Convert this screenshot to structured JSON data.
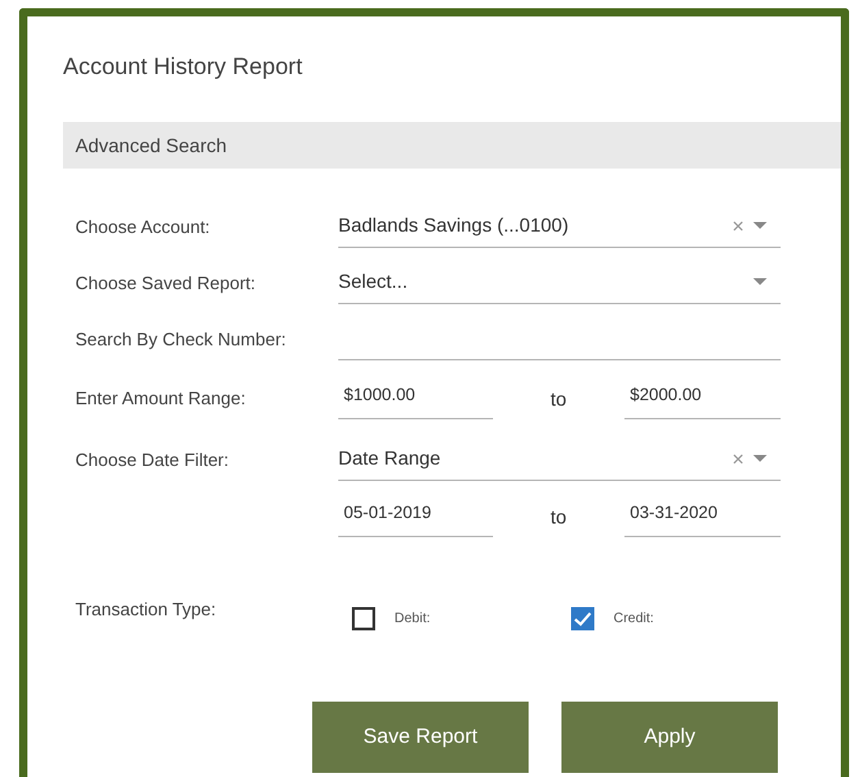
{
  "title": "Account History Report",
  "section": "Advanced Search",
  "fields": [
    {
      "kind": "select",
      "label": "Choose Account:",
      "value": "Badlands Savings (...0100)",
      "clearable": true
    },
    {
      "kind": "select",
      "label": "Choose Saved Report:",
      "placeholder": "Select...",
      "clearable": false
    },
    {
      "kind": "text",
      "label": "Search By Check Number:"
    },
    {
      "kind": "range",
      "label": "Enter Amount Range:",
      "from": "$1000.00",
      "separator": "to",
      "to": "$2000.00"
    },
    {
      "kind": "select",
      "label": "Choose Date Filter:",
      "value": "Date Range",
      "clearable": true
    },
    {
      "kind": "range",
      "from": "05-01-2019",
      "separator": "to",
      "to": "03-31-2020"
    },
    {
      "kind": "checks",
      "label": "Transaction Type:",
      "options": [
        {
          "label": "Debit:",
          "checked": false
        },
        {
          "label": "Credit:",
          "checked": true
        }
      ]
    }
  ],
  "buttons": [
    "Save Report",
    "Apply"
  ]
}
